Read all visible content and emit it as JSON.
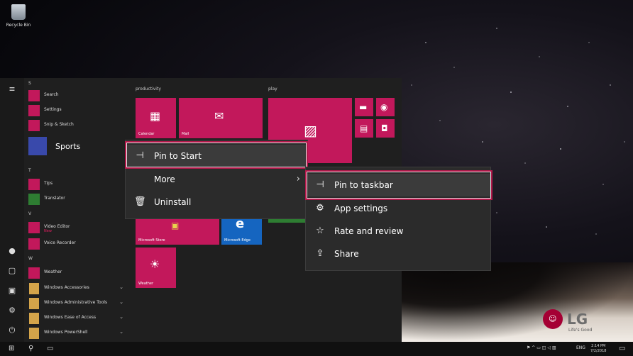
{
  "desktop": {
    "recycle_bin": "Recycle Bin"
  },
  "start_menu": {
    "rail_icons": [
      "hamburger-icon",
      "user-icon",
      "document-icon",
      "pictures-icon",
      "settings-icon",
      "power-icon"
    ],
    "letters": {
      "s": "S",
      "t": "T",
      "v": "V",
      "w": "W"
    },
    "apps": {
      "search": "Search",
      "settings": "Settings",
      "snip": "Snip & Sketch",
      "sports": "Sports",
      "tips": "Tips",
      "translator": "Translator",
      "video_editor": "Video Editor",
      "video_editor_badge": "New",
      "voice_recorder": "Voice Recorder",
      "weather": "Weather",
      "accessories": "Windows Accessories",
      "admin_tools": "Windows Administrative Tools",
      "ease_access": "Windows Ease of Access",
      "powershell": "Windows PowerShell"
    },
    "groups": {
      "productivity": "productivity",
      "play": "play"
    },
    "tiles": {
      "calendar": "Calendar",
      "mail": "Mail",
      "store": "Microsoft Store",
      "edge": "Microsoft Edge",
      "weather": "Weather"
    }
  },
  "context_menu": {
    "pin_to_start": "Pin to Start",
    "more": "More",
    "uninstall": "Uninstall"
  },
  "submenu": {
    "pin_to_taskbar": "Pin to taskbar",
    "app_settings": "App settings",
    "rate_review": "Rate and review",
    "share": "Share"
  },
  "taskbar": {
    "lang": "ENG",
    "time": "2:14 PM",
    "date": "7/2/2018"
  },
  "brand": {
    "logo": "LG",
    "tagline": "Life's Good"
  },
  "colors": {
    "accent": "#c2185b",
    "highlight": "#b2184a",
    "menu_bg": "#2b2b2b"
  }
}
